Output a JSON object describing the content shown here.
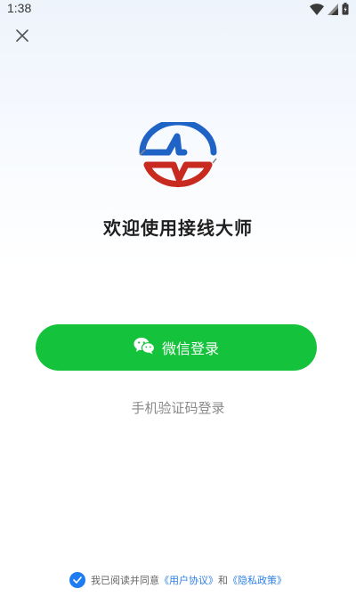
{
  "status_bar": {
    "time": "1:38",
    "icons": [
      "wifi-icon",
      "signal-icon",
      "battery-icon"
    ]
  },
  "header": {
    "close_icon": "close-icon"
  },
  "app": {
    "title": "欢迎使用接线大师",
    "logo": "bolt-logo",
    "logo_colors": {
      "blue": "#1f63c6",
      "red": "#c92a1f"
    }
  },
  "login": {
    "wechat_label": "微信登录",
    "wechat_icon": "wechat-icon",
    "wechat_color": "#15c23c",
    "phone_label": "手机验证码登录"
  },
  "agreement": {
    "prefix": "我已阅读并同意",
    "user_agreement": "《用户协议》",
    "conjunction": "和",
    "privacy_policy": "《隐私政策》",
    "checked": true,
    "accent_color": "#1e7cf2"
  }
}
